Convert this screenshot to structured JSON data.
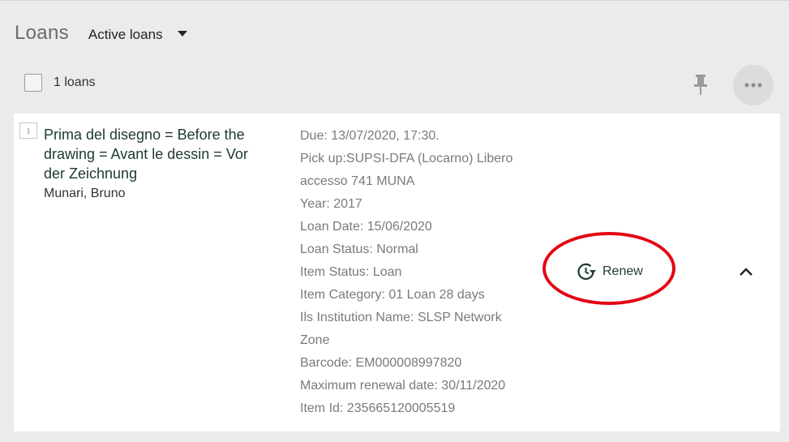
{
  "header": {
    "title": "Loans",
    "filter_label": "Active loans"
  },
  "toolbar": {
    "count_label": "1 loans"
  },
  "loan": {
    "index": "1",
    "title": "Prima del disegno = Before the drawing = Avant le dessin = Vor der Zeichnung",
    "author": "Munari, Bruno",
    "details": [
      "Due: 13/07/2020, 17:30.",
      "Pick up:SUPSI-DFA (Locarno) Libero accesso 741 MUNA",
      "Year: 2017",
      "Loan Date: 15/06/2020",
      "Loan Status: Normal",
      "Item Status: Loan",
      "Item Category: 01 Loan 28 days",
      "Ils Institution Name: SLSP Network Zone",
      "Barcode: EM000008997820",
      "Maximum renewal date: 30/11/2020",
      "Item Id: 235665120005519"
    ],
    "renew_label": "Renew"
  },
  "colors": {
    "accent": "#1e3a2c",
    "highlight": "#e30613",
    "detail_text": "#7a7a7a"
  },
  "icons": {
    "filter_dropdown": "caret-down-icon",
    "pin": "pin-icon",
    "more": "more-horizontal-icon",
    "renew": "renew-clock-icon",
    "collapse": "chevron-up-icon"
  }
}
